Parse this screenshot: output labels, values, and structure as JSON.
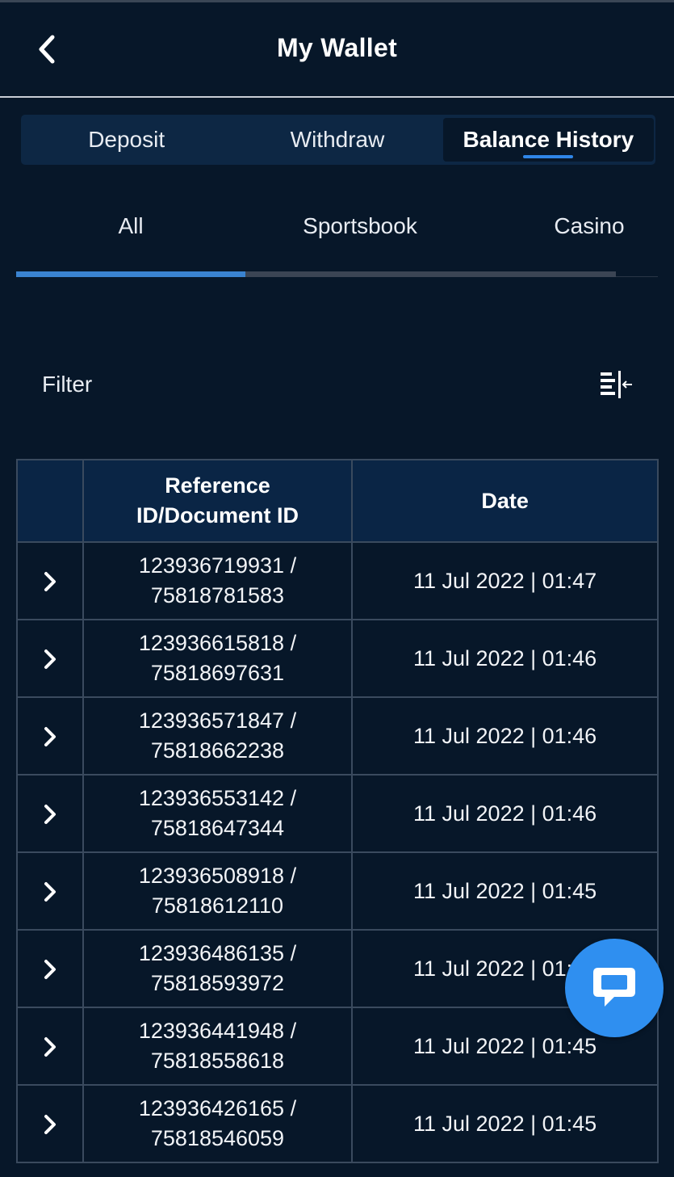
{
  "header": {
    "title": "My Wallet"
  },
  "tabs": [
    {
      "label": "Deposit",
      "active": false
    },
    {
      "label": "Withdraw",
      "active": false
    },
    {
      "label": "Balance History",
      "active": true
    }
  ],
  "subtabs": [
    {
      "label": "All",
      "active": true
    },
    {
      "label": "Sportsbook",
      "active": false
    },
    {
      "label": "Casino",
      "active": false
    }
  ],
  "filter": {
    "label": "Filter",
    "icon": "filter-panel-icon"
  },
  "table": {
    "headers": [
      "",
      "Reference\nID/Document ID",
      "Date"
    ],
    "header_ref_line1": "Reference",
    "header_ref_line2": "ID/Document ID",
    "header_date": "Date",
    "rows": [
      {
        "ref": "123936719931 /",
        "doc": "75818781583",
        "date": "11 Jul 2022 | 01:47"
      },
      {
        "ref": "123936615818 /",
        "doc": "75818697631",
        "date": "11 Jul 2022 | 01:46"
      },
      {
        "ref": "123936571847 /",
        "doc": "75818662238",
        "date": "11 Jul 2022 | 01:46"
      },
      {
        "ref": "123936553142 /",
        "doc": "75818647344",
        "date": "11 Jul 2022 | 01:46"
      },
      {
        "ref": "123936508918 /",
        "doc": "75818612110",
        "date": "11 Jul 2022 | 01:45"
      },
      {
        "ref": "123936486135 /",
        "doc": "75818593972",
        "date": "11 Jul 2022 | 01:45"
      },
      {
        "ref": "123936441948 /",
        "doc": "75818558618",
        "date": "11 Jul 2022 | 01:45"
      },
      {
        "ref": "123936426165 /",
        "doc": "75818546059",
        "date": "11 Jul 2022 | 01:45"
      }
    ]
  },
  "colors": {
    "background": "#071729",
    "accent": "#2f86e8",
    "chat": "#2f8ff0",
    "tab_bar": "#0d2744"
  },
  "icons": {
    "back": "chevron-left-icon",
    "row_expand": "chevron-right-icon",
    "chat": "chat-bubble-icon"
  }
}
